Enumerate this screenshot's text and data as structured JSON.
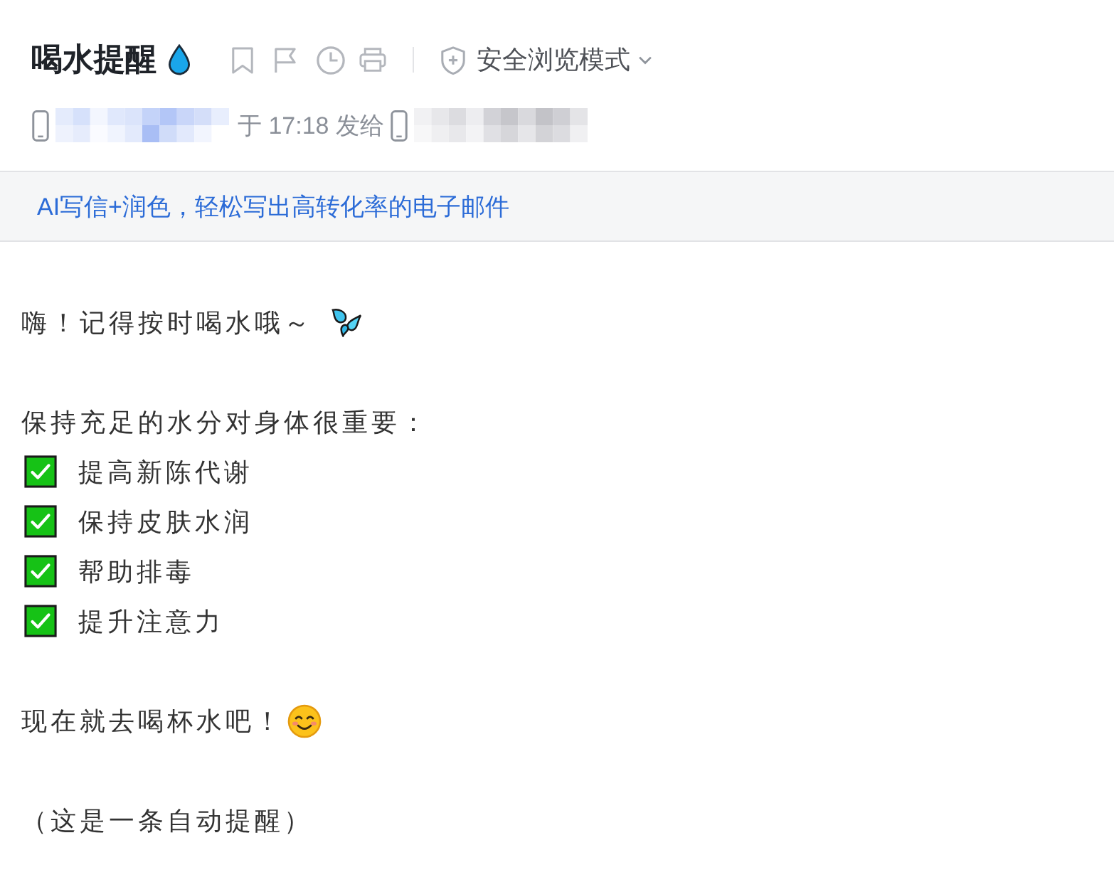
{
  "header": {
    "title": "喝水提醒",
    "safe_mode_label": "安全浏览模式"
  },
  "meta": {
    "sent_text": "于 17:18 发给"
  },
  "banner": {
    "text": "AI写信+润色，轻松写出高转化率的电子邮件"
  },
  "body": {
    "greeting": "嗨！记得按时喝水哦～",
    "intro": "保持充足的水分对身体很重要：",
    "checklist": [
      {
        "text": "提高新陈代谢",
        "checked": true
      },
      {
        "text": "保持皮肤水润",
        "checked": true
      },
      {
        "text": "帮助排毒",
        "checked": true
      },
      {
        "text": "提升注意力",
        "checked": true
      }
    ],
    "call_to_action": "现在就去喝杯水吧！",
    "closing": "（这是一条自动提醒）"
  }
}
